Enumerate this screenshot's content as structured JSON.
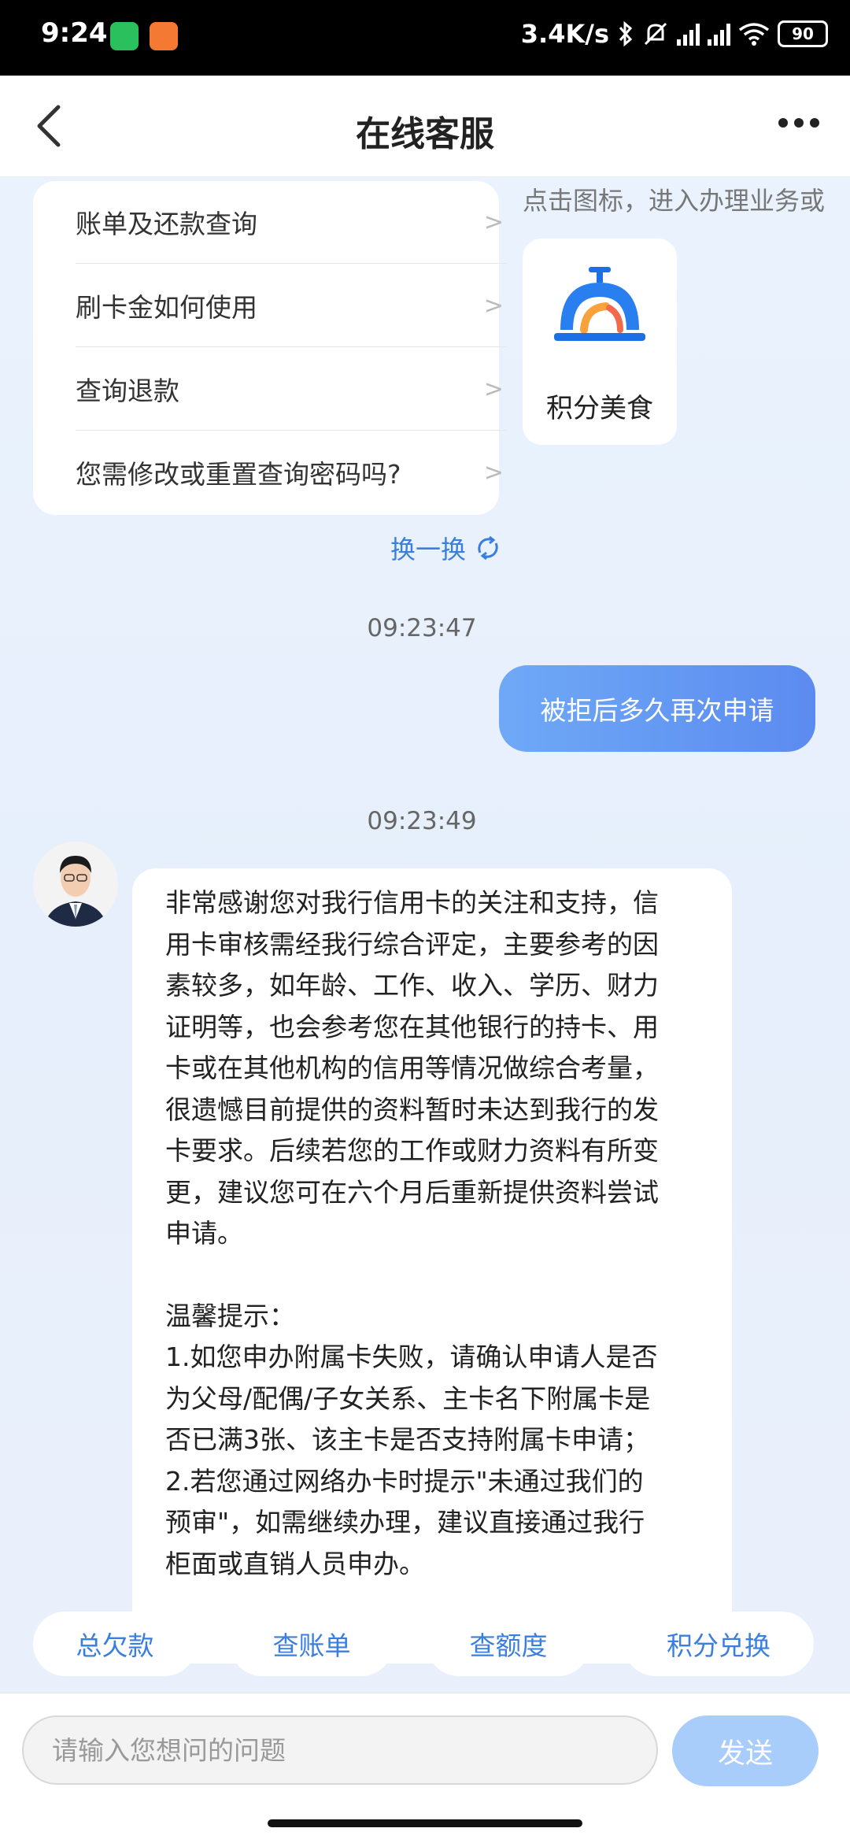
{
  "status_bar": {
    "time": "9:24",
    "network_speed": "3.4K/s",
    "battery": "90",
    "icons": [
      "wechat-icon",
      "heart-app-icon",
      "bluetooth-icon",
      "mute-bell-icon",
      "hd-signal-icon",
      "signal-icon",
      "wifi-icon",
      "battery-icon"
    ]
  },
  "header": {
    "title": "在线客服"
  },
  "faq": {
    "items": [
      {
        "label": "账单及还款查询",
        "arrow": ">"
      },
      {
        "label": "刷卡金如何使用",
        "arrow": ">"
      },
      {
        "label": "查询退款",
        "arrow": ">"
      },
      {
        "label": "您需修改或重置查询密码吗?",
        "arrow": ">"
      }
    ],
    "refresh_label": "换一换"
  },
  "service_panel": {
    "hint": "点击图标，进入办理业务或",
    "tile_label": "积分美食",
    "tile_icon": "service-bell-icon"
  },
  "messages": {
    "timestamp_1": "09:23:47",
    "user_message": "被拒后多久再次申请",
    "timestamp_2": "09:23:49",
    "bot_lines": [
      "非常感谢您对我行信用卡的关注和支持，信",
      "用卡审核需经我行综合评定，主要参考的因",
      "素较多，如年龄、工作、收入、学历、财力",
      "证明等，也会参考您在其他银行的持卡、用",
      "卡或在其他机构的信用等情况做综合考量，",
      "很遗憾目前提供的资料暂时未达到我行的发",
      "卡要求。后续若您的工作或财力资料有所变",
      "更，建议您可在六个月后重新提供资料尝试",
      "申请。",
      "",
      "温馨提示：",
      "1.如您申办附属卡失败，请确认申请人是否",
      "为父母/配偶/子女关系、主卡名下附属卡是",
      "否已满3张、该主卡是否支持附属卡申请；",
      "2.若您通过网络办卡时提示\"未通过我们的",
      "预审\"，如需继续办理，建议直接通过我行",
      "柜面或直销人员申办。"
    ]
  },
  "quick_actions": [
    "总欠款",
    "查账单",
    "查额度",
    "积分兑换"
  ],
  "input": {
    "placeholder": "请输入您想问的问题",
    "send_label": "发送"
  },
  "colors": {
    "accent": "#3a7fe0",
    "user_bubble": "#6a9ff5",
    "send_button": "#a9cdfb"
  }
}
